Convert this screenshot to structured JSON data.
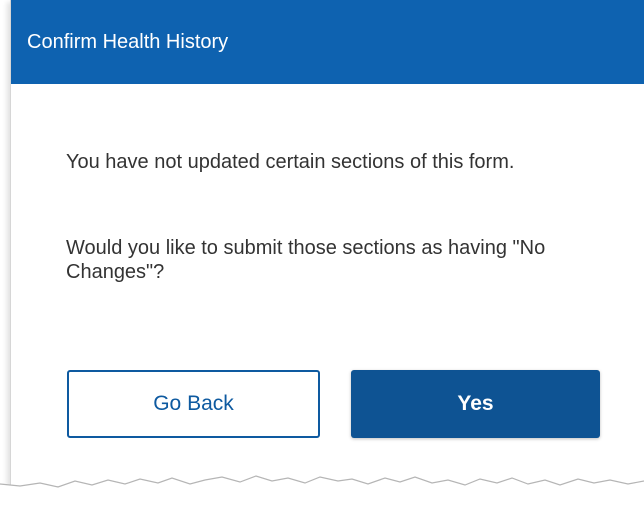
{
  "dialog": {
    "title": "Confirm Health History",
    "message_line_1": "You have not updated certain sections of this form.",
    "message_line_2": "Would you like to submit those sections as having \"No Changes\"?",
    "buttons": {
      "back_label": "Go Back",
      "yes_label": "Yes"
    }
  },
  "colors": {
    "header_background": "#0e62b0",
    "primary_button": "#0e5393",
    "secondary_button_border": "#0e5aa0"
  }
}
